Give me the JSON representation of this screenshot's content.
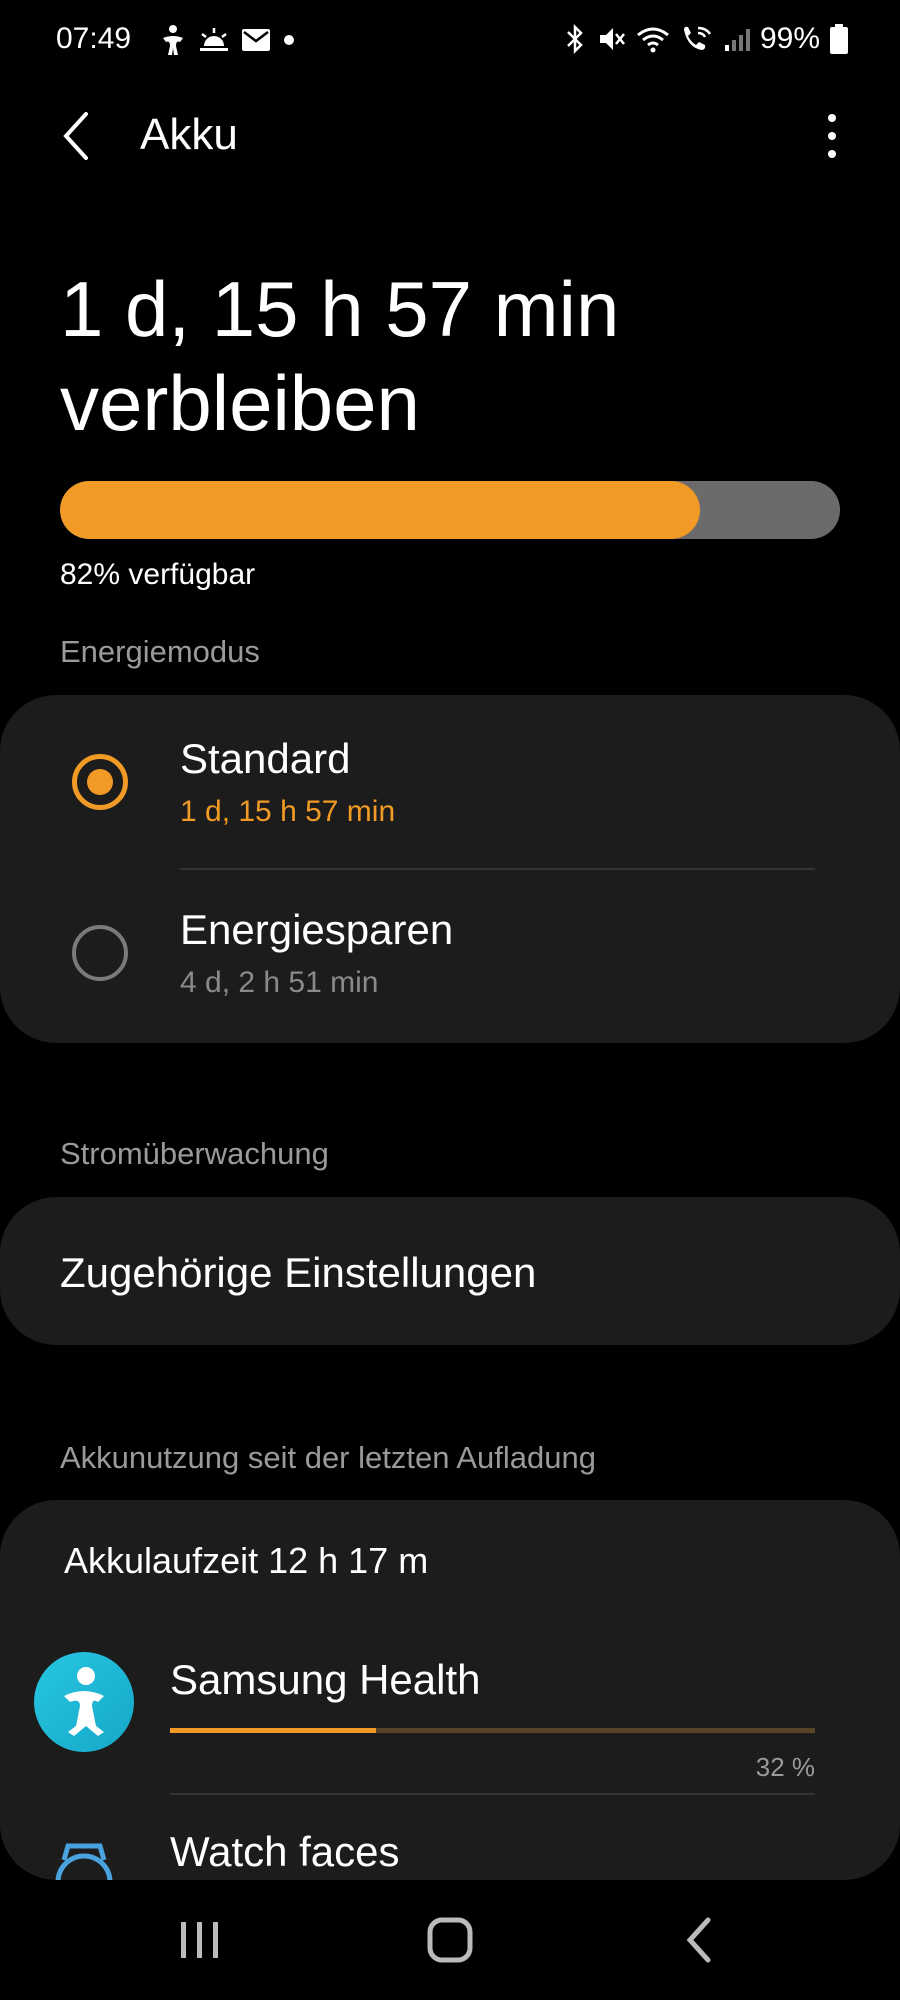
{
  "status_bar": {
    "time": "07:49",
    "battery_percent": "99%",
    "left_icons": [
      "accessibility-icon",
      "sunrise-icon",
      "mail-icon",
      "dot-icon"
    ],
    "right_icons": [
      "bluetooth-icon",
      "mute-icon",
      "wifi-icon",
      "wifi-call-icon",
      "signal-icon",
      "battery-icon"
    ]
  },
  "app_bar": {
    "title": "Akku"
  },
  "battery": {
    "remaining_line1": "1 d, 15 h 57 min",
    "remaining_line2": "verbleiben",
    "available_label": "82% verfügbar",
    "level_fraction": 0.82,
    "fill_color": "#f19a25",
    "track_color": "#6b6b6b"
  },
  "power_mode": {
    "section_label": "Energiemodus",
    "options": [
      {
        "label": "Standard",
        "estimate": "1 d, 15 h 57 min",
        "selected": true
      },
      {
        "label": "Energiesparen",
        "estimate": "4 d, 2 h 51 min",
        "selected": false
      }
    ]
  },
  "power_monitor": {
    "section_label": "Stromüberwachung",
    "related_settings": "Zugehörige Einstellungen"
  },
  "usage": {
    "section_label": "Akkunutzung seit der letzten Aufladung",
    "battery_time": "Akkulaufzeit 12 h 17 m",
    "apps": [
      {
        "name": "Samsung Health",
        "percent_label": "32 %",
        "fraction": 0.32
      },
      {
        "name": "Watch faces"
      }
    ]
  },
  "nav_bar": {
    "buttons": [
      "recent-apps-icon",
      "home-icon",
      "back-icon"
    ]
  },
  "colors": {
    "accent": "#f19a25",
    "background": "#000000",
    "card": "#1c1c1c",
    "secondary_text": "#9a9a9a"
  }
}
